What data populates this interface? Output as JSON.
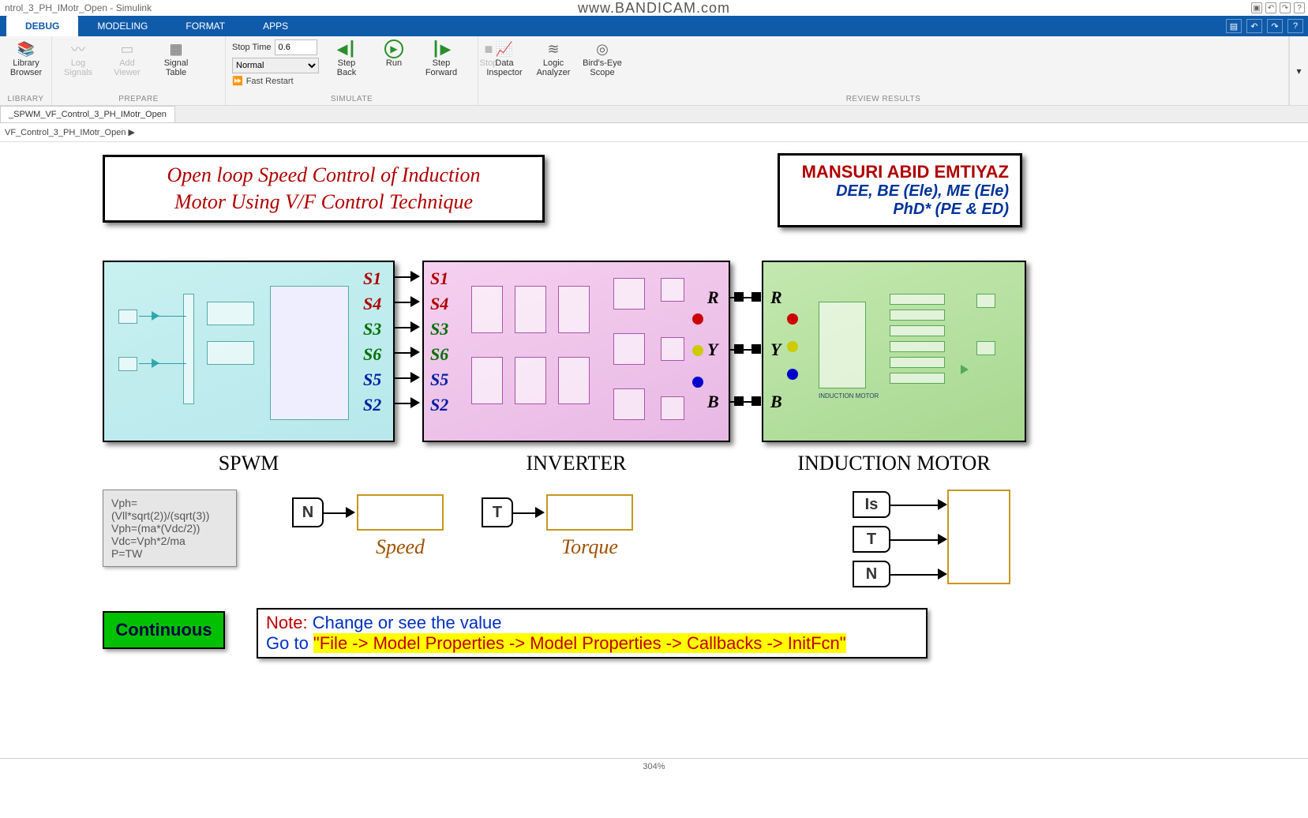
{
  "window": {
    "title": "ntrol_3_PH_IMotr_Open - Simulink",
    "watermark": "www.BANDICAM.com"
  },
  "menu": {
    "tabs": [
      "DEBUG",
      "MODELING",
      "FORMAT",
      "APPS"
    ],
    "active": 0
  },
  "ribbon": {
    "library": {
      "btn": "Library\nBrowser",
      "label": "LIBRARY"
    },
    "prepare": {
      "log": "Log\nSignals",
      "add": "Add\nViewer",
      "table": "Signal\nTable",
      "label": "PREPARE"
    },
    "simulate": {
      "stopTimeLabel": "Stop Time",
      "stopTime": "0.6",
      "mode": "Normal",
      "fastRestart": "Fast Restart",
      "stepBack": "Step\nBack",
      "run": "Run",
      "stepFwd": "Step\nForward",
      "stop": "Stop",
      "label": "SIMULATE"
    },
    "review": {
      "di": "Data\nInspector",
      "la": "Logic\nAnalyzer",
      "be": "Bird's-Eye\nScope",
      "label": "REVIEW RESULTS"
    }
  },
  "docTab": "_SPWM_VF_Control_3_PH_IMotr_Open",
  "breadcrumb": "VF_Control_3_PH_IMotr_Open ▶",
  "title1": "Open loop Speed Control of Induction",
  "title2": "Motor Using V/F Control Technique",
  "author": {
    "name": "MANSURI ABID EMTIYAZ",
    "l2": "DEE, BE (Ele), ME (Ele)",
    "l3": "PhD* (PE & ED)"
  },
  "blocks": {
    "spwm": "SPWM",
    "inverter": "INVERTER",
    "motor": "INDUCTION MOTOR"
  },
  "spwm_ports": [
    "S1",
    "S4",
    "S3",
    "S6",
    "S5",
    "S2"
  ],
  "inv_ports_in": [
    "S1",
    "S4",
    "S3",
    "S6",
    "S5",
    "S2"
  ],
  "inv_ports_out": [
    "R",
    "Y",
    "B"
  ],
  "mot_ports_in": [
    "R",
    "Y",
    "B"
  ],
  "port_colors": [
    "c-red",
    "c-red",
    "c-grn",
    "c-grn",
    "c-blu",
    "c-blu"
  ],
  "ryb_colors": [
    "c-blk",
    "c-blk",
    "c-blk"
  ],
  "formulas": [
    "Vph=(Vll*sqrt(2))/(sqrt(3))",
    "Vph=(ma*(Vdc/2))",
    "Vdc=Vph*2/ma",
    "P=TW"
  ],
  "disp": {
    "n": "N",
    "t": "T",
    "is": "Is",
    "speed": "Speed",
    "torque": "Torque"
  },
  "continuous": "Continuous",
  "note": {
    "prefix": "Note:",
    "l1": " Change or see the value",
    "l2a": "Go to ",
    "l2b": "\"File -> Model Properties -> Model Properties -> Callbacks -> InitFcn\""
  },
  "zoom": "304%"
}
